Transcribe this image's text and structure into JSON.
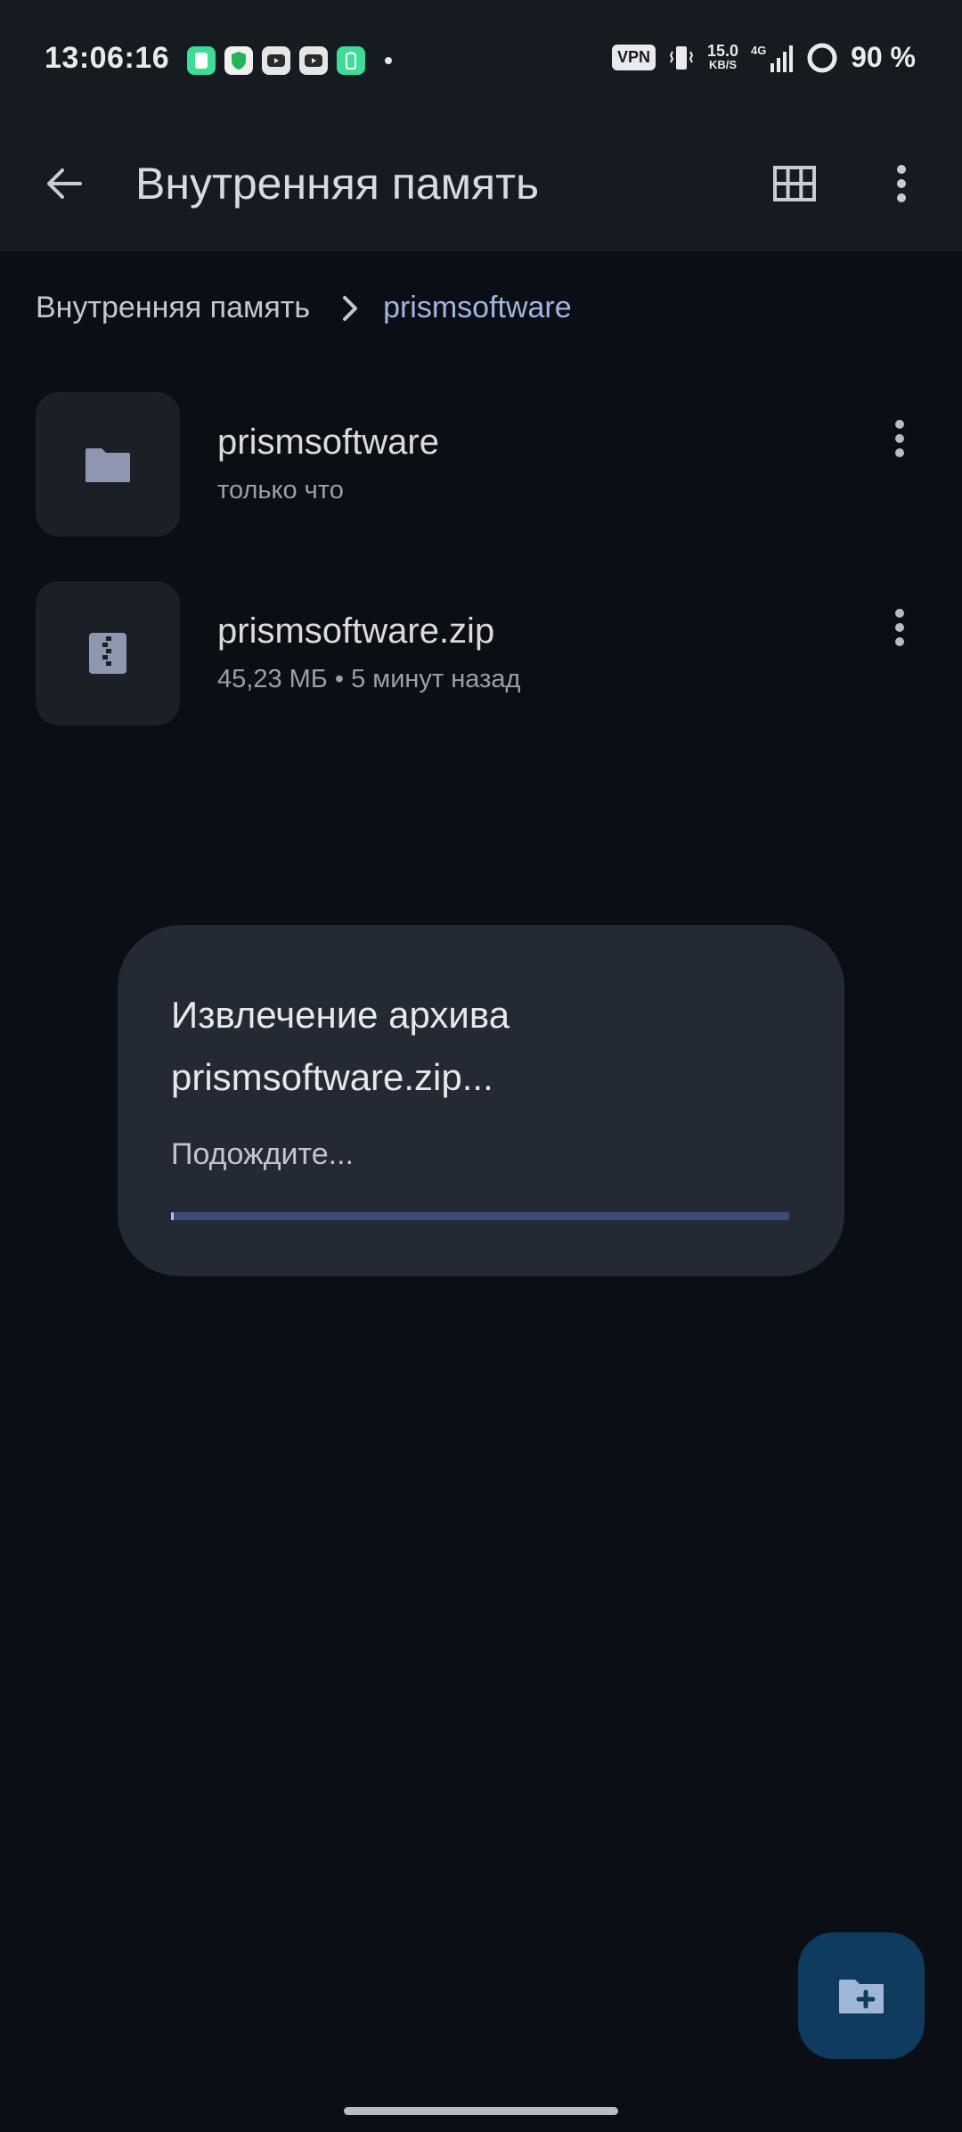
{
  "status_bar": {
    "time": "13:06:16",
    "vpn": "VPN",
    "net_speed_value": "15.0",
    "net_speed_unit": "KB/S",
    "signal_label": "4G",
    "battery": "90 %"
  },
  "app_bar": {
    "title": "Внутренняя память"
  },
  "breadcrumb": {
    "root": "Внутренняя память",
    "current": "prismsoftware"
  },
  "files": [
    {
      "name": "prismsoftware",
      "meta": "только что",
      "icon": "folder-icon"
    },
    {
      "name": "prismsoftware.zip",
      "meta": "45,23 МБ • 5 минут назад",
      "icon": "zip-icon"
    }
  ],
  "dialog": {
    "title": "Извлечение архива prismsoftware.zip...",
    "subtitle": "Подождите...",
    "progress": 0.005
  },
  "colors": {
    "background": "#0b0e14",
    "bar": "#161b22",
    "dialog": "#242a33",
    "accent": "#9fb6e0",
    "fab": "#0f3b5e"
  }
}
